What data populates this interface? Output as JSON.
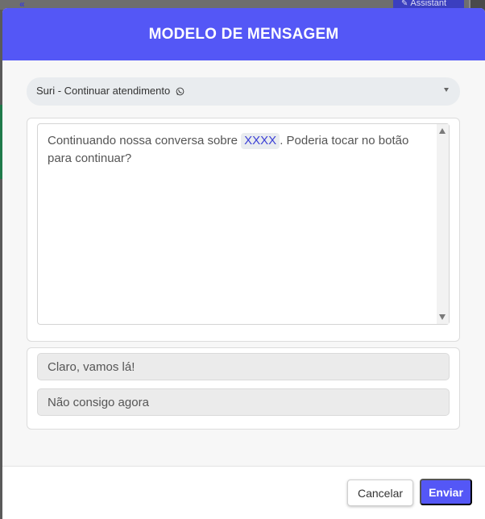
{
  "background": {
    "back_icon": "double-chevron-left-icon",
    "assistant_label": "Assistant",
    "assistant_icon": "magic-wand-icon"
  },
  "modal": {
    "title": "MODELO DE MENSAGEM",
    "template_select": {
      "selected": "Suri - Continuar atendimento",
      "icon": "whatsapp-icon"
    },
    "message": {
      "text_before": "Continuando nossa conversa sobre ",
      "variable": "XXXX",
      "text_after": ". Poderia tocar no botão para continuar?"
    },
    "quick_replies": [
      "Claro, vamos lá!",
      "Não consigo agora"
    ],
    "footer": {
      "cancel_label": "Cancelar",
      "send_label": "Enviar"
    }
  },
  "colors": {
    "accent": "#5457f6",
    "variable_text": "#3b3fd6"
  }
}
